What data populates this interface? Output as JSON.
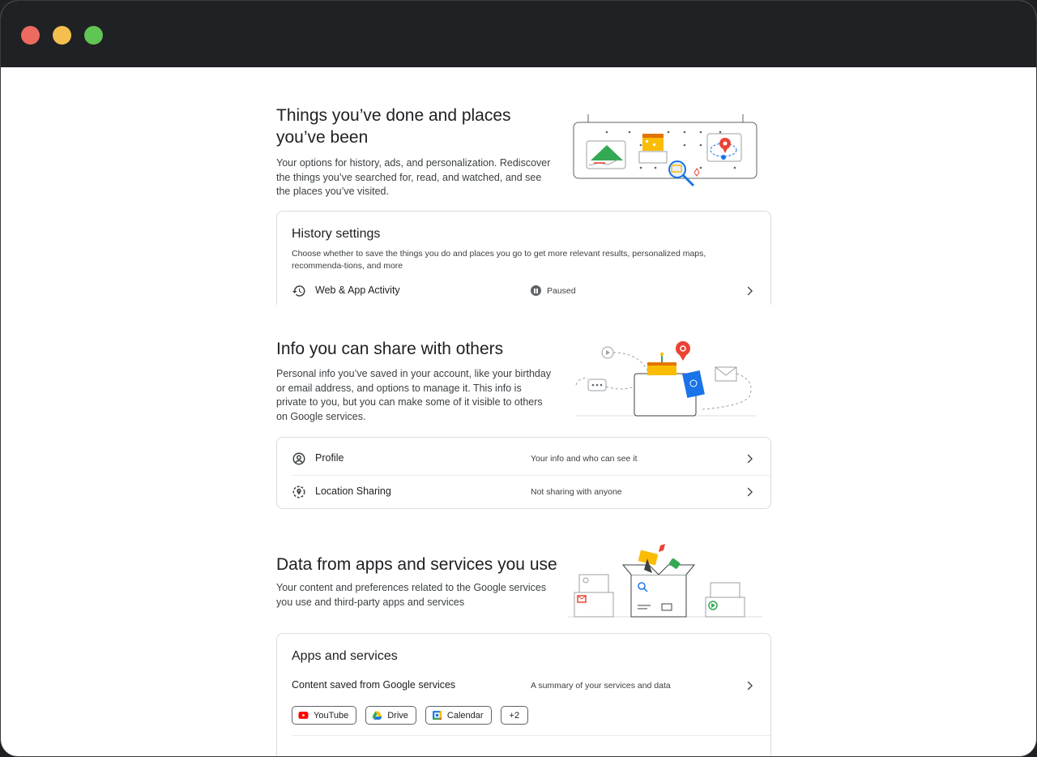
{
  "sections": {
    "history": {
      "title_line1": "Things you’ve done and places",
      "title_line2": "you’ve been",
      "description": "Your options for history, ads, and personalization. Rediscover the things you’ve searched for, read, and watched, and see the places you’ve visited.",
      "card": {
        "heading": "History settings",
        "subtext": "Choose whether to save the things you do and places you go to get more relevant results, personalized maps, recommenda-tions, and more",
        "rows": [
          {
            "label": "Web & App Activity",
            "status": "Paused",
            "icon": "history-icon"
          }
        ]
      }
    },
    "share": {
      "title": "Info you can share with others",
      "description": "Personal info you’ve saved in your account, like your birthday or email address, and options to manage it. This info is private to you, but you can make some of it visible to others on Google services.",
      "rows": [
        {
          "label": "Profile",
          "value": "Your info and who can see it",
          "icon": "profile-icon"
        },
        {
          "label": "Location Sharing",
          "value": "Not sharing with anyone",
          "icon": "location-sharing-icon"
        }
      ]
    },
    "data": {
      "title": "Data from apps and services you use",
      "description": "Your content and preferences related to the Google services you use and third-party apps and services",
      "card": {
        "heading": "Apps and services",
        "row": {
          "label": "Content saved from Google services",
          "value": "A summary of your services and data"
        },
        "chips": [
          {
            "label": "YouTube",
            "icon": "youtube-icon"
          },
          {
            "label": "Drive",
            "icon": "drive-icon"
          },
          {
            "label": "Calendar",
            "icon": "calendar-icon"
          },
          {
            "label": "+2"
          }
        ]
      }
    }
  },
  "colors": {
    "window_chrome": "#202124",
    "close": "#ec6a5f",
    "minimize": "#f4bf4f",
    "maximize": "#61c554",
    "google_blue": "#1a73e8",
    "google_red": "#ea4335",
    "google_yellow": "#fbbc04",
    "google_green": "#34a853"
  }
}
